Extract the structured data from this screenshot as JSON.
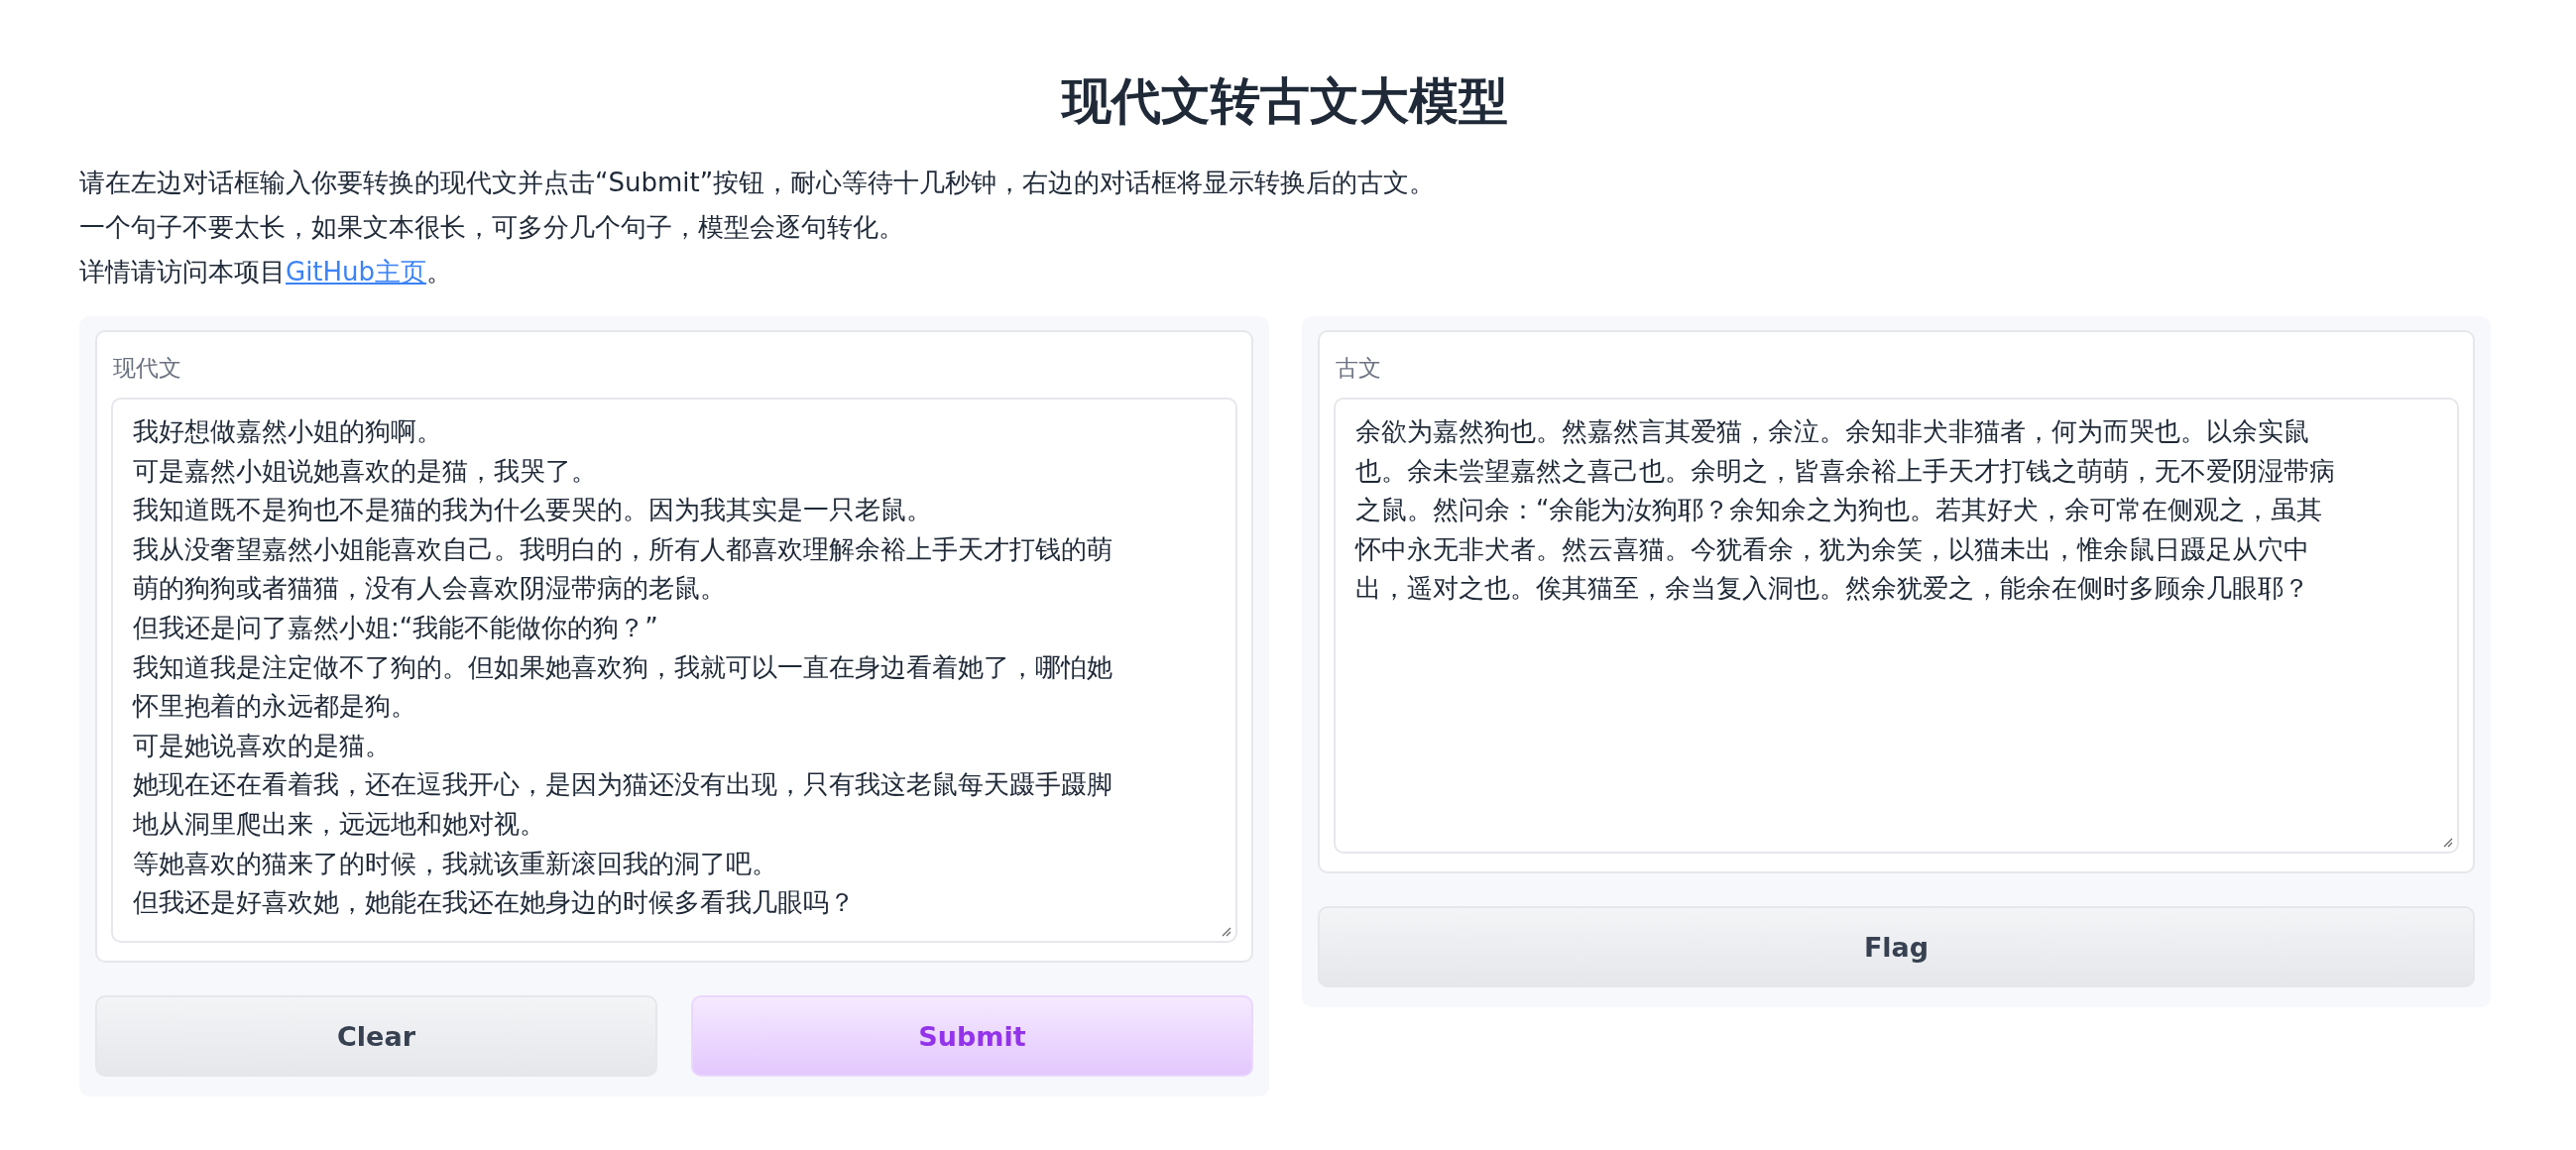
{
  "title": "现代文转古文大模型",
  "intro": {
    "lines": [
      "请在左边对话框输入你要转换的现代文并点击“Submit”按钮，耐心等待十几秒钟，右边的对话框将显示转换后的古文。",
      "一个句子不要太长，如果文本很长，可多分几个句子，模型会逐句转化。"
    ],
    "link_line": {
      "prefix": "详情请访问本项目",
      "link": "GitHub主页",
      "suffix": "。"
    }
  },
  "input_panel": {
    "label": "现代文",
    "lines": [
      "我好想做嘉然小姐的狗啊。",
      "可是嘉然小姐说她喜欢的是猫，我哭了。",
      "我知道既不是狗也不是猫的我为什么要哭的。因为我其实是一只老鼠。",
      "我从没奢望嘉然小姐能喜欢自己。我明白的，所有人都喜欢理解余裕上手天才打钱的萌",
      "萌的狗狗或者猫猫，没有人会喜欢阴湿带病的老鼠。",
      "但我还是问了嘉然小姐:“我能不能做你的狗？”",
      "我知道我是注定做不了狗的。但如果她喜欢狗，我就可以一直在身边看着她了，哪怕她",
      "怀里抱着的永远都是狗。",
      "可是她说喜欢的是猫。",
      "她现在还在看着我，还在逗我开心，是因为猫还没有出现，只有我这老鼠每天蹑手蹑脚",
      "地从洞里爬出来，远远地和她对视。",
      "等她喜欢的猫来了的时候，我就该重新滚回我的洞了吧。",
      "但我还是好喜欢她，她能在我还在她身边的时候多看我几眼吗？"
    ],
    "buttons": [
      {
        "label": "Clear",
        "kind": "secondary"
      },
      {
        "label": "Submit",
        "kind": "primary"
      }
    ]
  },
  "output_panel": {
    "label": "古文",
    "lines": [
      "余欲为嘉然狗也。然嘉然言其爱猫，余泣。余知非犬非猫者，何为而哭也。以余实鼠",
      "也。余未尝望嘉然之喜己也。余明之，皆喜余裕上手天才打钱之萌萌，无不爱阴湿带病",
      "之鼠。然问余：“余能为汝狗耶？余知余之为狗也。若其好犬，余可常在侧观之，虽其",
      "怀中永无非犬者。然云喜猫。今犹看余，犹为余笑，以猫未出，惟余鼠日蹑足从穴中",
      "出，遥对之也。俟其猫至，余当复入洞也。然余犹爱之，能余在侧时多顾余几眼耶？"
    ],
    "button": {
      "label": "Flag",
      "kind": "secondary"
    }
  }
}
